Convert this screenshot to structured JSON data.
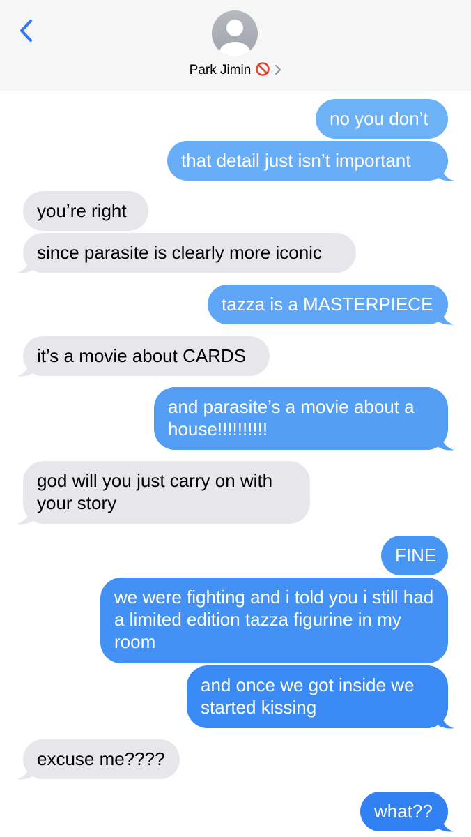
{
  "header": {
    "contact_name": "Park Jimin",
    "back_icon": "chevron-left-icon",
    "blocked_icon": "no-entry-icon",
    "disclosure_icon": "chevron-right-icon",
    "avatar_icon": "person-silhouette-icon",
    "accent_color": "#3478f6"
  },
  "messages": [
    {
      "from": "me",
      "text": "no you don’t"
    },
    {
      "from": "me",
      "text": "that detail just isn’t important"
    },
    {
      "from": "them",
      "text": "you’re right"
    },
    {
      "from": "them",
      "text": "since parasite is clearly more iconic"
    },
    {
      "from": "me",
      "text": "tazza is a MASTERPIECE"
    },
    {
      "from": "them",
      "text": "it’s a movie about CARDS"
    },
    {
      "from": "me",
      "text": "and parasite’s a movie about a house!!!!!!!!!!"
    },
    {
      "from": "them",
      "text": "god will you just carry on with your story"
    },
    {
      "from": "me",
      "text": "FINE"
    },
    {
      "from": "me",
      "text": "we were fighting and i told you i still had a limited edition tazza figurine in my room"
    },
    {
      "from": "me",
      "text": "and once we got inside we started kissing"
    },
    {
      "from": "them",
      "text": "excuse me????"
    },
    {
      "from": "me",
      "text": "what??"
    }
  ]
}
